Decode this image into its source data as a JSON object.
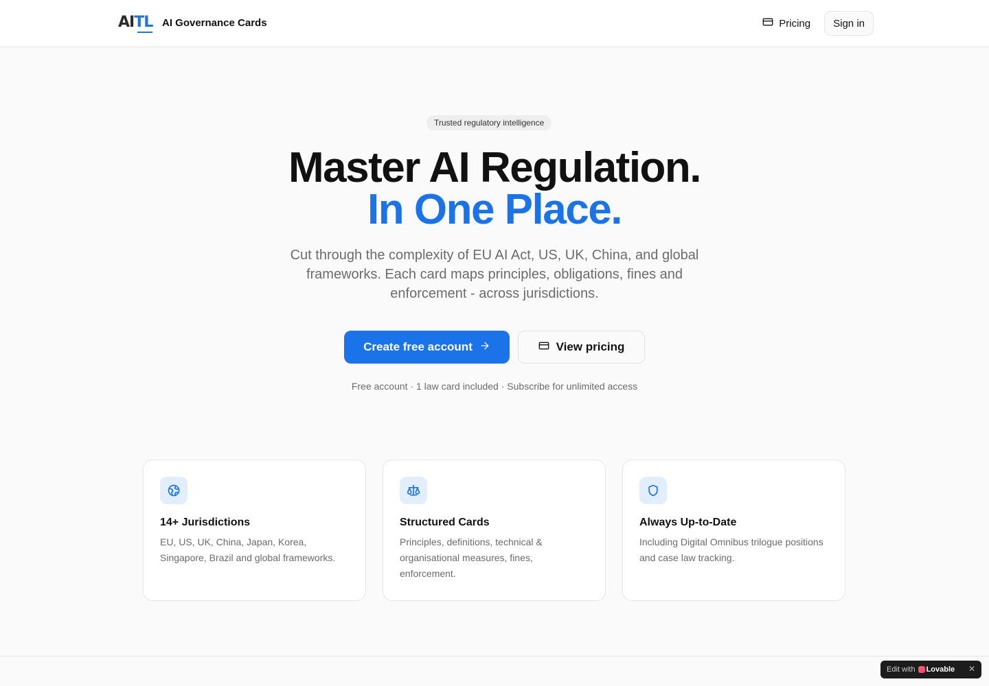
{
  "header": {
    "logo_letters": "AITL",
    "brand_name": "AI Governance Cards",
    "nav_pricing": "Pricing",
    "sign_in": "Sign in"
  },
  "hero": {
    "badge": "Trusted regulatory intelligence",
    "title_line1": "Master AI Regulation.",
    "title_line2": "In One Place.",
    "lead": "Cut through the complexity of EU AI Act, US, UK, China, and global frameworks. Each card maps principles, obligations, fines and enforcement - across jurisdictions.",
    "cta_primary": "Create free account",
    "cta_secondary": "View pricing",
    "fineprint": "Free account · 1 law card included · Subscribe for unlimited access"
  },
  "features": [
    {
      "icon": "globe-icon",
      "title": "14+ Jurisdictions",
      "desc": "EU, US, UK, China, Japan, Korea, Singapore, Brazil and global frameworks."
    },
    {
      "icon": "scale-icon",
      "title": "Structured Cards",
      "desc": "Principles, definitions, technical & organisational measures, fines, enforcement."
    },
    {
      "icon": "shield-icon",
      "title": "Always Up-to-Date",
      "desc": "Including Digital Omnibus trilogue positions and case law tracking."
    }
  ],
  "lovable_badge": {
    "prefix": "Edit with",
    "brand": "Lovable",
    "close": "✕"
  },
  "colors": {
    "accent": "#1a73e8",
    "text": "#111111",
    "muted": "#6b6b6b",
    "background": "#fafafa"
  }
}
